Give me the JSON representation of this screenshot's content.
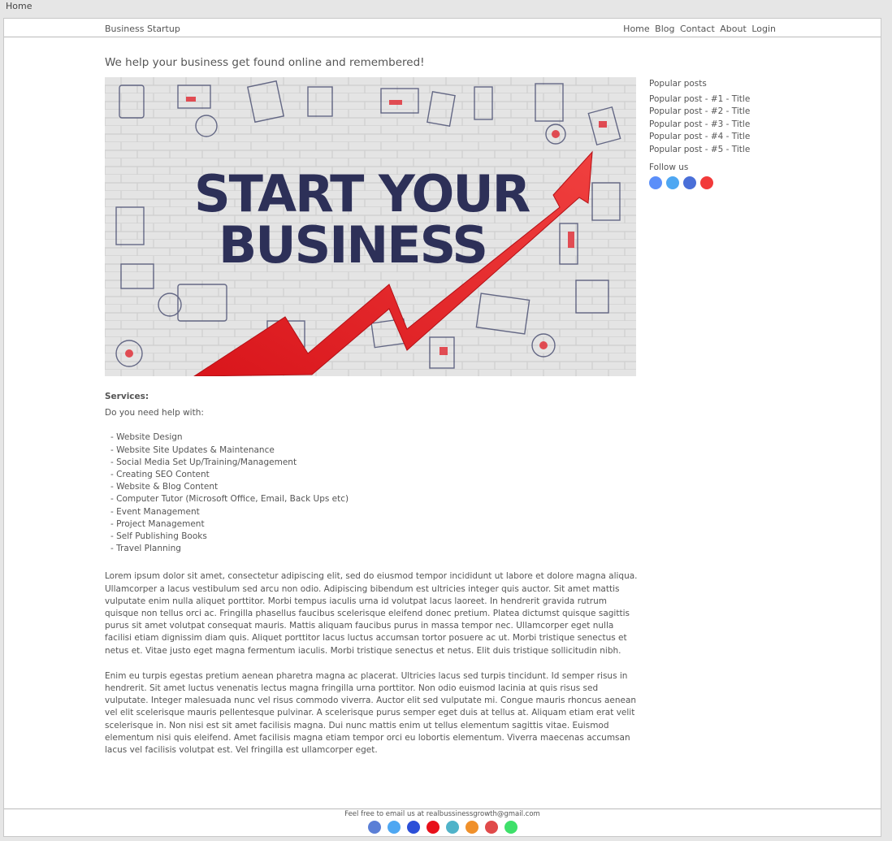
{
  "browser": {
    "tab_label": "Home"
  },
  "nav": {
    "brand": "Business Startup",
    "links": [
      "Home",
      "Blog",
      "Contact",
      "About",
      "Login"
    ]
  },
  "hero": {
    "tagline": "We help your business get found online and remembered!",
    "image_text_line1": "START YOUR",
    "image_text_line2": "BUSINESS"
  },
  "sidebar": {
    "popular_title": "Popular posts",
    "posts": [
      "Popular post - #1 - Title",
      "Popular post - #2 - Title",
      "Popular post - #3 - Title",
      "Popular post - #4 - Title",
      "Popular post - #5 - Title"
    ],
    "follow_title": "Follow us",
    "social_colors": [
      "#5b8ff9",
      "#4ea7f2",
      "#4a6fd8",
      "#f23a3a"
    ]
  },
  "content": {
    "services_title": "Services:",
    "intro": "Do you need help with:",
    "services": [
      "- Website Design",
      "- Website Site Updates & Maintenance",
      "- Social Media Set Up/Training/Management",
      "- Creating SEO Content",
      "- Website & Blog Content",
      "- Computer Tutor (Microsoft Office, Email, Back Ups etc)",
      "- Event Management",
      "- Project Management",
      "- Self Publishing Books",
      "- Travel Planning"
    ],
    "paragraph1": "Lorem ipsum dolor sit amet, consectetur adipiscing elit, sed do eiusmod tempor incididunt ut labore et dolore magna aliqua. Ullamcorper a lacus vestibulum sed arcu non odio. Adipiscing bibendum est ultricies integer quis auctor. Sit amet mattis vulputate enim nulla aliquet porttitor. Morbi tempus iaculis urna id volutpat lacus laoreet. In hendrerit gravida rutrum quisque non tellus orci ac. Fringilla phasellus faucibus scelerisque eleifend donec pretium. Platea dictumst quisque sagittis purus sit amet volutpat consequat mauris. Mattis aliquam faucibus purus in massa tempor nec. Ullamcorper eget nulla facilisi etiam dignissim diam quis. Aliquet porttitor lacus luctus accumsan tortor posuere ac ut. Morbi tristique senectus et netus et. Vitae justo eget magna fermentum iaculis. Morbi tristique senectus et netus. Elit duis tristique sollicitudin nibh.",
    "paragraph2": "Enim eu turpis egestas pretium aenean pharetra magna ac placerat. Ultricies lacus sed turpis tincidunt. Id semper risus in hendrerit. Sit amet luctus venenatis lectus magna fringilla urna porttitor. Non odio euismod lacinia at quis risus sed vulputate. Integer malesuada nunc vel risus commodo viverra. Auctor elit sed vulputate mi. Congue mauris rhoncus aenean vel elit scelerisque mauris pellentesque pulvinar. A scelerisque purus semper eget duis at tellus at. Aliquam etiam erat velit scelerisque in. Non nisi est sit amet facilisis magna. Dui nunc mattis enim ut tellus elementum sagittis vitae. Euismod elementum nisi quis eleifend. Amet facilisis magna etiam tempor orci eu lobortis elementum. Viverra maecenas accumsan lacus vel facilisis volutpat est. Vel fringilla est ullamcorper eget."
  },
  "footer": {
    "email_text": "Feel free to email us at realbussinessgrowth@gmail.com",
    "social_colors": [
      "#5b7fd6",
      "#4ea7f2",
      "#2b4fd8",
      "#e8101a",
      "#4fb3c9",
      "#f0902a",
      "#e04a4a",
      "#3ee06a"
    ]
  }
}
